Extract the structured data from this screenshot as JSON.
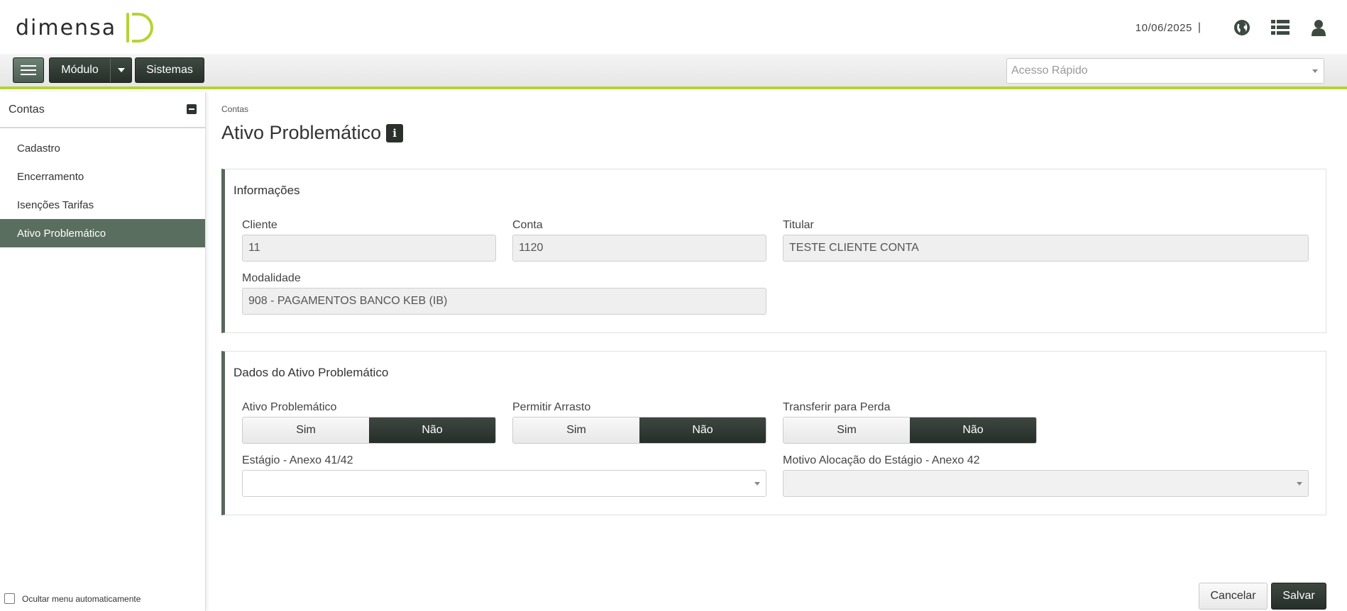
{
  "header": {
    "logo_text": "DIMENSA",
    "date": "10/06/2025",
    "separator": "|",
    "icons": [
      "globe-icon",
      "list-icon",
      "user-icon"
    ]
  },
  "navbar": {
    "modulo_label": "Módulo",
    "sistemas_label": "Sistemas",
    "quick_access_placeholder": "Acesso Rápido"
  },
  "sidebar": {
    "title": "Contas",
    "items": [
      {
        "label": "Cadastro",
        "active": false
      },
      {
        "label": "Encerramento",
        "active": false
      },
      {
        "label": "Isenções Tarifas",
        "active": false
      },
      {
        "label": "Ativo Problemático",
        "active": true
      }
    ],
    "auto_hide_label": "Ocultar menu automaticamente"
  },
  "main": {
    "breadcrumb": "Contas",
    "title": "Ativo Problemático",
    "info_panel": {
      "title": "Informações",
      "cliente_label": "Cliente",
      "cliente_value": "11",
      "conta_label": "Conta",
      "conta_value": "1120",
      "titular_label": "Titular",
      "titular_value": "TESTE CLIENTE CONTA",
      "modalidade_label": "Modalidade",
      "modalidade_value": "908 - PAGAMENTOS BANCO KEB (IB)"
    },
    "dados_panel": {
      "title": "Dados do Ativo Problemático",
      "ativo_label": "Ativo Problemático",
      "arrasto_label": "Permitir Arrasto",
      "perda_label": "Transferir para Perda",
      "sim": "Sim",
      "nao": "Não",
      "estagio_label": "Estágio - Anexo 41/42",
      "motivo_label": "Motivo Alocação do Estágio - Anexo 42"
    },
    "actions": {
      "cancel": "Cancelar",
      "save": "Salvar"
    }
  },
  "colors": {
    "accent": "#b5d334",
    "dark": "#263029",
    "sidebar_active": "#5a6e5f"
  }
}
